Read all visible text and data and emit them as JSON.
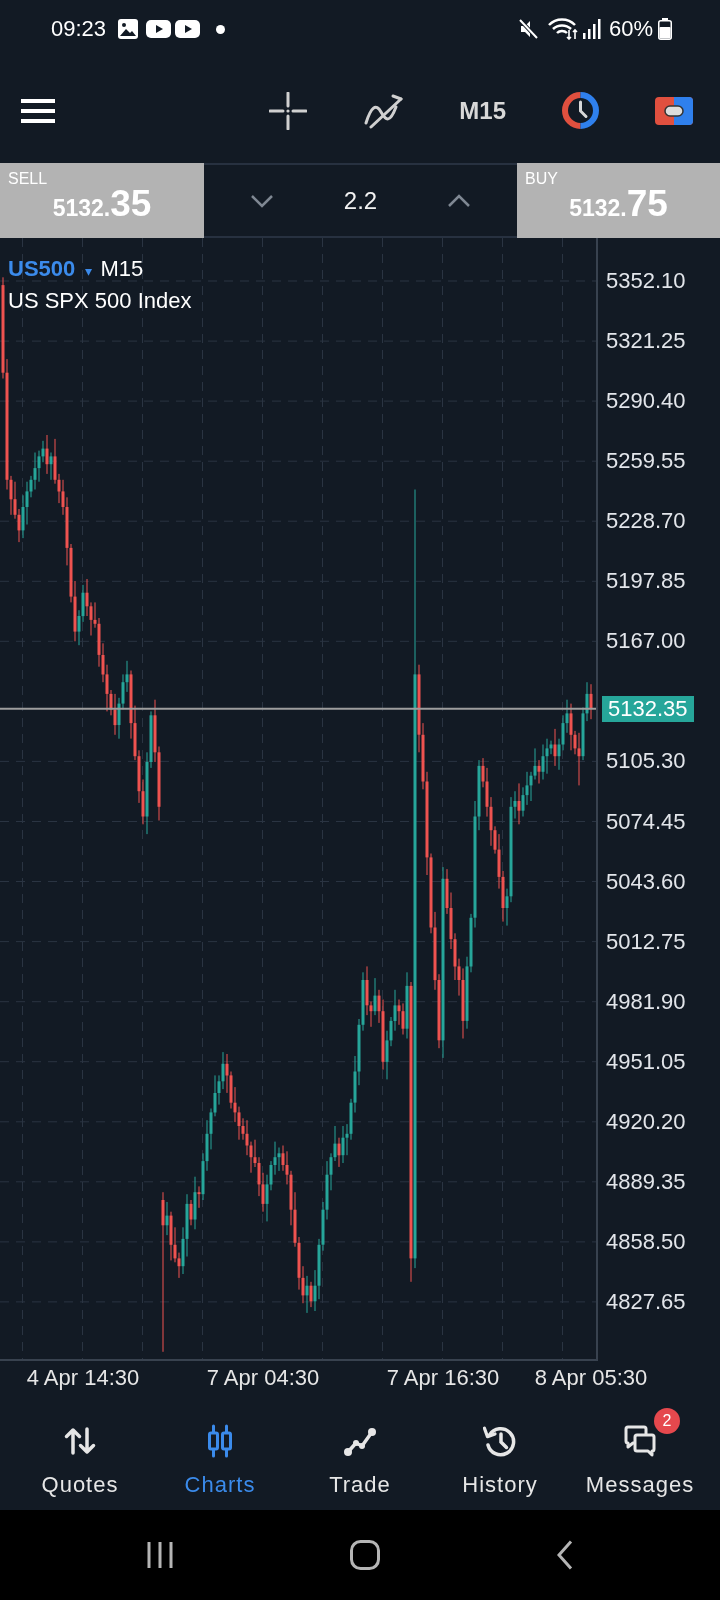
{
  "status_bar": {
    "time": "09:23",
    "battery": "60%"
  },
  "toolbar": {
    "timeframe": "M15"
  },
  "trade_panel": {
    "sell": {
      "label": "SELL",
      "price_main": "5132.",
      "price_pips": "35"
    },
    "volume": "2.2",
    "buy": {
      "label": "BUY",
      "price_main": "5132.",
      "price_pips": "75"
    }
  },
  "chart": {
    "symbol": "US500",
    "symbol_caret": "▾",
    "timeframe": "M15",
    "description": "US SPX 500 Index",
    "current_price": "5132.35",
    "chart_data": {
      "type": "candlestick",
      "grid": true,
      "ylim": [
        4797.3,
        5374.2
      ],
      "ref_lines": [
        {
          "axis": "y",
          "value": 5132.35
        }
      ],
      "categories": [
        null,
        null,
        null,
        null,
        null,
        null,
        null,
        null,
        null,
        null,
        null,
        null,
        null,
        null,
        null,
        null,
        null,
        null,
        null,
        null,
        "4 Apr 14:30",
        null,
        null,
        null,
        null,
        null,
        null,
        null,
        null,
        null,
        null,
        null,
        null,
        null,
        null,
        null,
        null,
        null,
        null,
        null,
        null,
        null,
        null,
        null,
        null,
        null,
        null,
        null,
        null,
        null,
        null,
        null,
        null,
        null,
        null,
        null,
        null,
        null,
        null,
        null,
        null,
        null,
        null,
        null,
        null,
        "7 Apr 04:30",
        null,
        null,
        null,
        null,
        null,
        null,
        null,
        null,
        null,
        null,
        null,
        null,
        null,
        null,
        null,
        null,
        null,
        null,
        null,
        null,
        null,
        null,
        null,
        null,
        null,
        null,
        null,
        null,
        null,
        null,
        null,
        null,
        null,
        null,
        null,
        null,
        null,
        null,
        null,
        null,
        null,
        null,
        null,
        null,
        "7 Apr 16:30",
        null,
        null,
        null,
        null,
        null,
        null,
        null,
        null,
        null,
        null,
        null,
        null,
        null,
        null,
        null,
        null,
        null,
        null,
        null,
        null,
        null,
        null,
        null,
        null,
        null,
        null,
        null,
        null,
        null,
        null,
        null,
        null,
        null,
        null,
        null,
        null,
        "8 Apr 05:30"
      ],
      "yticks": [
        {
          "value": 5352.1,
          "label": "5352.10"
        },
        {
          "value": 5321.25,
          "label": "5321.25"
        },
        {
          "value": 5290.4,
          "label": "5290.40"
        },
        {
          "value": 5259.55,
          "label": "5259.55"
        },
        {
          "value": 5228.7,
          "label": "5228.70"
        },
        {
          "value": 5197.85,
          "label": "5197.85"
        },
        {
          "value": 5167,
          "label": "5167.00"
        },
        {
          "value": 5105.3,
          "label": "5105.30"
        },
        {
          "value": 5074.45,
          "label": "5074.45"
        },
        {
          "value": 5043.6,
          "label": "5043.60"
        },
        {
          "value": 5012.75,
          "label": "5012.75"
        },
        {
          "value": 4981.9,
          "label": "4981.90"
        },
        {
          "value": 4951.05,
          "label": "4951.05"
        },
        {
          "value": 4920.2,
          "label": "4920.20"
        },
        {
          "value": 4889.35,
          "label": "4889.35"
        },
        {
          "value": 4858.5,
          "label": "4858.50"
        },
        {
          "value": 4827.65,
          "label": "4827.65"
        }
      ],
      "ohlc": [
        [
          5350,
          5354,
          5302,
          5305
        ],
        [
          5305,
          5312,
          5245,
          5250
        ],
        [
          5250,
          5252,
          5232,
          5240
        ],
        [
          5240,
          5249,
          5230,
          5232
        ],
        [
          5232,
          5235,
          5218,
          5224
        ],
        [
          5224,
          5242,
          5220,
          5236
        ],
        [
          5236,
          5249,
          5227,
          5244
        ],
        [
          5244,
          5252,
          5241,
          5250
        ],
        [
          5250,
          5264,
          5245,
          5256
        ],
        [
          5256,
          5265,
          5249,
          5262
        ],
        [
          5262,
          5270,
          5259,
          5266
        ],
        [
          5266,
          5273,
          5253,
          5258
        ],
        [
          5258,
          5264,
          5250,
          5262
        ],
        [
          5262,
          5271,
          5248,
          5250
        ],
        [
          5250,
          5253,
          5238,
          5244
        ],
        [
          5244,
          5250,
          5232,
          5236
        ],
        [
          5236,
          5241,
          5206,
          5215
        ],
        [
          5215,
          5217,
          5187,
          5190
        ],
        [
          5190,
          5198,
          5167,
          5172
        ],
        [
          5172,
          5183,
          5165,
          5180
        ],
        [
          5180,
          5196,
          5177,
          5192
        ],
        [
          5192,
          5199,
          5180,
          5185
        ],
        [
          5185,
          5187,
          5170,
          5178
        ],
        [
          5178,
          5187,
          5174,
          5176
        ],
        [
          5176,
          5179,
          5154,
          5160
        ],
        [
          5160,
          5166,
          5146,
          5150
        ],
        [
          5150,
          5155,
          5131,
          5140
        ],
        [
          5140,
          5142,
          5129,
          5132
        ],
        [
          5132,
          5140,
          5119,
          5124
        ],
        [
          5124,
          5138,
          5117,
          5135
        ],
        [
          5135,
          5150,
          5132,
          5146
        ],
        [
          5146,
          5157,
          5141,
          5150
        ],
        [
          5150,
          5152,
          5117,
          5125
        ],
        [
          5125,
          5134,
          5106,
          5108
        ],
        [
          5108,
          5111,
          5084,
          5090
        ],
        [
          5090,
          5096,
          5073,
          5077
        ],
        [
          5077,
          5110,
          5068,
          5105
        ],
        [
          5105,
          5131,
          5102,
          5129
        ],
        [
          5129,
          5137,
          5105,
          5110
        ],
        [
          5110,
          5113,
          5075,
          5082
        ],
        [
          4880,
          4884,
          4802,
          4867
        ],
        [
          4867,
          4879,
          4862,
          4872
        ],
        [
          4872,
          4874,
          4849,
          4857
        ],
        [
          4857,
          4866,
          4848,
          4850
        ],
        [
          4850,
          4853,
          4840,
          4846
        ],
        [
          4846,
          4866,
          4842,
          4860
        ],
        [
          4860,
          4883,
          4851,
          4878
        ],
        [
          4878,
          4880,
          4867,
          4870
        ],
        [
          4870,
          4892,
          4865,
          4884
        ],
        [
          4884,
          4887,
          4876,
          4883
        ],
        [
          4883,
          4904,
          4880,
          4900
        ],
        [
          4900,
          4921,
          4895,
          4914
        ],
        [
          4914,
          4927,
          4906,
          4925
        ],
        [
          4925,
          4944,
          4923,
          4935
        ],
        [
          4935,
          4944,
          4929,
          4941
        ],
        [
          4941,
          4956,
          4937,
          4950
        ],
        [
          4950,
          4955,
          4935,
          4944
        ],
        [
          4944,
          4946,
          4927,
          4930
        ],
        [
          4930,
          4938,
          4920,
          4925
        ],
        [
          4925,
          4928,
          4911,
          4918
        ],
        [
          4918,
          4922,
          4911,
          4914
        ],
        [
          4914,
          4921,
          4903,
          4908
        ],
        [
          4908,
          4910,
          4894,
          4902
        ],
        [
          4902,
          4911,
          4897,
          4899
        ],
        [
          4899,
          4902,
          4882,
          4888
        ],
        [
          4888,
          4894,
          4874,
          4878
        ],
        [
          4878,
          4893,
          4869,
          4888
        ],
        [
          4888,
          4900,
          4885,
          4898
        ],
        [
          4898,
          4910,
          4893,
          4902
        ],
        [
          4902,
          4907,
          4895,
          4904
        ],
        [
          4904,
          4908,
          4895,
          4898
        ],
        [
          4898,
          4905,
          4888,
          4893
        ],
        [
          4893,
          4895,
          4867,
          4875
        ],
        [
          4875,
          4884,
          4856,
          4858
        ],
        [
          4858,
          4861,
          4834,
          4840
        ],
        [
          4840,
          4846,
          4827,
          4831
        ],
        [
          4831,
          4841,
          4822,
          4836
        ],
        [
          4836,
          4838,
          4825,
          4828
        ],
        [
          4828,
          4844,
          4823,
          4836
        ],
        [
          4836,
          4860,
          4829,
          4857
        ],
        [
          4857,
          4879,
          4854,
          4875
        ],
        [
          4875,
          4900,
          4870,
          4893
        ],
        [
          4893,
          4904,
          4885,
          4902
        ],
        [
          4902,
          4918,
          4900,
          4909
        ],
        [
          4909,
          4912,
          4897,
          4903
        ],
        [
          4903,
          4918,
          4899,
          4912
        ],
        [
          4912,
          4919,
          4903,
          4914
        ],
        [
          4914,
          4932,
          4911,
          4930
        ],
        [
          4930,
          4954,
          4925,
          4946
        ],
        [
          4946,
          4973,
          4939,
          4970
        ],
        [
          4970,
          4997,
          4967,
          4993
        ],
        [
          4993,
          5000,
          4975,
          4980
        ],
        [
          4980,
          4982,
          4969,
          4977
        ],
        [
          4977,
          4994,
          4975,
          4985
        ],
        [
          4985,
          4988,
          4971,
          4977
        ],
        [
          4977,
          4983,
          4947,
          4951
        ],
        [
          4951,
          4967,
          4942,
          4962
        ],
        [
          4962,
          4974,
          4959,
          4972
        ],
        [
          4972,
          4988,
          4967,
          4980
        ],
        [
          4980,
          4983,
          4970,
          4977
        ],
        [
          4977,
          4981,
          4965,
          4968
        ],
        [
          4968,
          4997,
          4963,
          4990
        ],
        [
          4990,
          4992,
          4838,
          4850
        ],
        [
          4850,
          5245,
          4845,
          5150
        ],
        [
          5150,
          5155,
          5110,
          5119
        ],
        [
          5119,
          5125,
          5091,
          5095
        ],
        [
          5095,
          5100,
          5047,
          5056
        ],
        [
          5056,
          5058,
          5017,
          5020
        ],
        [
          5020,
          5028,
          4988,
          4993
        ],
        [
          4993,
          4996,
          4958,
          4962
        ],
        [
          4962,
          5051,
          4953,
          5045
        ],
        [
          5045,
          5050,
          5027,
          5030
        ],
        [
          5030,
          5038,
          5009,
          5014
        ],
        [
          5014,
          5017,
          4993,
          5000
        ],
        [
          5000,
          5004,
          4985,
          4993
        ],
        [
          4993,
          4999,
          4963,
          4972
        ],
        [
          4972,
          5005,
          4968,
          5000
        ],
        [
          5000,
          5027,
          4997,
          5025
        ],
        [
          5025,
          5085,
          5020,
          5077
        ],
        [
          5077,
          5106,
          5070,
          5103
        ],
        [
          5103,
          5107,
          5092,
          5095
        ],
        [
          5095,
          5102,
          5077,
          5082
        ],
        [
          5082,
          5087,
          5062,
          5070
        ],
        [
          5070,
          5072,
          5058,
          5060
        ],
        [
          5060,
          5068,
          5040,
          5046
        ],
        [
          5046,
          5049,
          5023,
          5030
        ],
        [
          5030,
          5040,
          5021,
          5036
        ],
        [
          5036,
          5087,
          5033,
          5082
        ],
        [
          5082,
          5090,
          5076,
          5085
        ],
        [
          5085,
          5094,
          5073,
          5080
        ],
        [
          5080,
          5092,
          5077,
          5088
        ],
        [
          5088,
          5100,
          5083,
          5093
        ],
        [
          5093,
          5100,
          5085,
          5098
        ],
        [
          5098,
          5112,
          5096,
          5103
        ],
        [
          5103,
          5106,
          5094,
          5100
        ],
        [
          5100,
          5114,
          5096,
          5108
        ],
        [
          5108,
          5117,
          5099,
          5112
        ],
        [
          5112,
          5116,
          5109,
          5114
        ],
        [
          5114,
          5122,
          5103,
          5108
        ],
        [
          5108,
          5117,
          5101,
          5114
        ],
        [
          5114,
          5129,
          5111,
          5125
        ],
        [
          5125,
          5137,
          5120,
          5130
        ],
        [
          5130,
          5135,
          5111,
          5119
        ],
        [
          5119,
          5121,
          5109,
          5112
        ],
        [
          5112,
          5120,
          5093,
          5108
        ],
        [
          5108,
          5133,
          5106,
          5130
        ],
        [
          5130,
          5146,
          5126,
          5140
        ],
        [
          5140,
          5145,
          5127,
          5132.35
        ]
      ]
    }
  },
  "bottom_nav": [
    {
      "label": "Quotes",
      "selected": false
    },
    {
      "label": "Charts",
      "selected": true
    },
    {
      "label": "Trade",
      "selected": false
    },
    {
      "label": "History",
      "selected": false
    },
    {
      "label": "Messages",
      "selected": false,
      "badge": "2"
    }
  ]
}
